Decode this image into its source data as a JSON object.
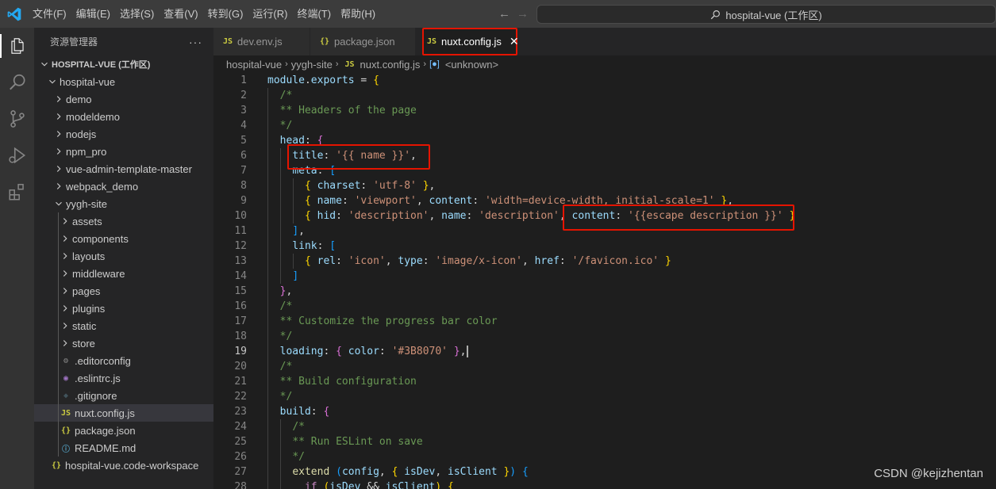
{
  "menu": [
    "文件(F)",
    "编辑(E)",
    "选择(S)",
    "查看(V)",
    "转到(G)",
    "运行(R)",
    "终端(T)",
    "帮助(H)"
  ],
  "search": {
    "text": "hospital-vue (工作区)"
  },
  "sidebar": {
    "title": "资源管理器",
    "more": "···",
    "workspace": "HOSPITAL-VUE (工作区)",
    "items": [
      {
        "label": "hospital-vue"
      },
      {
        "label": "demo"
      },
      {
        "label": "modeldemo"
      },
      {
        "label": "nodejs"
      },
      {
        "label": "npm_pro"
      },
      {
        "label": "vue-admin-template-master"
      },
      {
        "label": "webpack_demo"
      },
      {
        "label": "yygh-site"
      },
      {
        "label": "assets"
      },
      {
        "label": "components"
      },
      {
        "label": "layouts"
      },
      {
        "label": "middleware"
      },
      {
        "label": "pages"
      },
      {
        "label": "plugins"
      },
      {
        "label": "static"
      },
      {
        "label": "store"
      },
      {
        "label": ".editorconfig"
      },
      {
        "label": ".eslintrc.js"
      },
      {
        "label": ".gitignore"
      },
      {
        "label": "nuxt.config.js"
      },
      {
        "label": "package.json"
      },
      {
        "label": "README.md"
      },
      {
        "label": "hospital-vue.code-workspace"
      }
    ]
  },
  "tabs": [
    {
      "label": "dev.env.js",
      "icon": "JS"
    },
    {
      "label": "package.json",
      "icon": "{}"
    },
    {
      "label": "nuxt.config.js",
      "icon": "JS"
    }
  ],
  "breadcrumb": {
    "parts": [
      "hospital-vue",
      "yygh-site",
      "nuxt.config.js",
      "<unknown>"
    ]
  },
  "editor": {
    "line_numbers": [
      "1",
      "2",
      "3",
      "4",
      "5",
      "6",
      "7",
      "8",
      "9",
      "10",
      "11",
      "12",
      "13",
      "14",
      "15",
      "16",
      "17",
      "18",
      "19",
      "20",
      "21",
      "22",
      "23",
      "24",
      "25",
      "26",
      "27",
      "28"
    ],
    "current_line": "19"
  },
  "watermark": "CSDN @kejizhentan",
  "colors": {
    "highlight_box": "#e51400",
    "accent": "#007acc"
  }
}
